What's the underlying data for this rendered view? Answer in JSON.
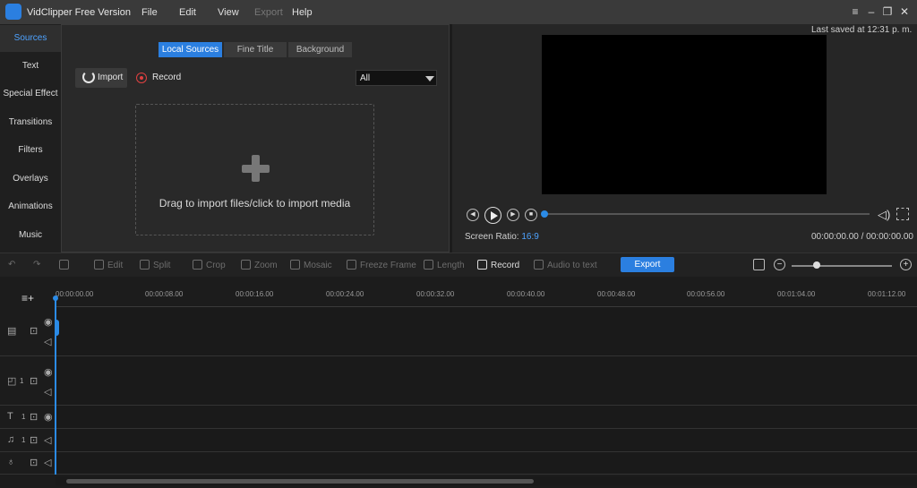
{
  "app": {
    "title": "VidClipper Free Version",
    "menu": [
      "File",
      "Edit",
      "View",
      "Export",
      "Help"
    ],
    "window_buttons": [
      "≡",
      "–",
      "❐",
      "✕"
    ]
  },
  "sidebar": {
    "items": [
      {
        "label": "Sources",
        "active": true
      },
      {
        "label": "Text"
      },
      {
        "label": "Special Effect"
      },
      {
        "label": "Transitions"
      },
      {
        "label": "Filters"
      },
      {
        "label": "Overlays"
      },
      {
        "label": "Animations"
      },
      {
        "label": "Music"
      }
    ]
  },
  "sources": {
    "tabs": [
      "Local Sources",
      "Fine Title",
      "Background"
    ],
    "import_label": "Import",
    "record_label": "Record",
    "filter_value": "All",
    "drop_text": "Drag to import files/click to import media"
  },
  "preview": {
    "last_saved": "Last saved at 12:31 p. m.",
    "ratio_label": "Screen Ratio:",
    "ratio_value": "16:9",
    "timecode": "00:00:00.00 / 00:00:00.00",
    "progress": 0
  },
  "toolbar": {
    "edit": "Edit",
    "split": "Split",
    "crop": "Crop",
    "zoom": "Zoom",
    "mosaic": "Mosaic",
    "freeze": "Freeze Frame",
    "length": "Length",
    "record": "Record",
    "audio_to_text": "Audio to text",
    "export": "Export",
    "zoom_level": 0.25
  },
  "timeline": {
    "ticks": [
      "00:00:00.00",
      "00:00:08.00",
      "00:00:16.00",
      "00:00:24.00",
      "00:00:32.00",
      "00:00:40.00",
      "00:00:48.00",
      "00:00:56.00",
      "00:01:04.00",
      "00:01:12.00"
    ],
    "track_counts": {
      "overlay": "1",
      "text": "1",
      "music": "1"
    }
  },
  "colors": {
    "accent": "#2b7fe0",
    "background": "#1c1c1c",
    "record": "#e04040"
  }
}
